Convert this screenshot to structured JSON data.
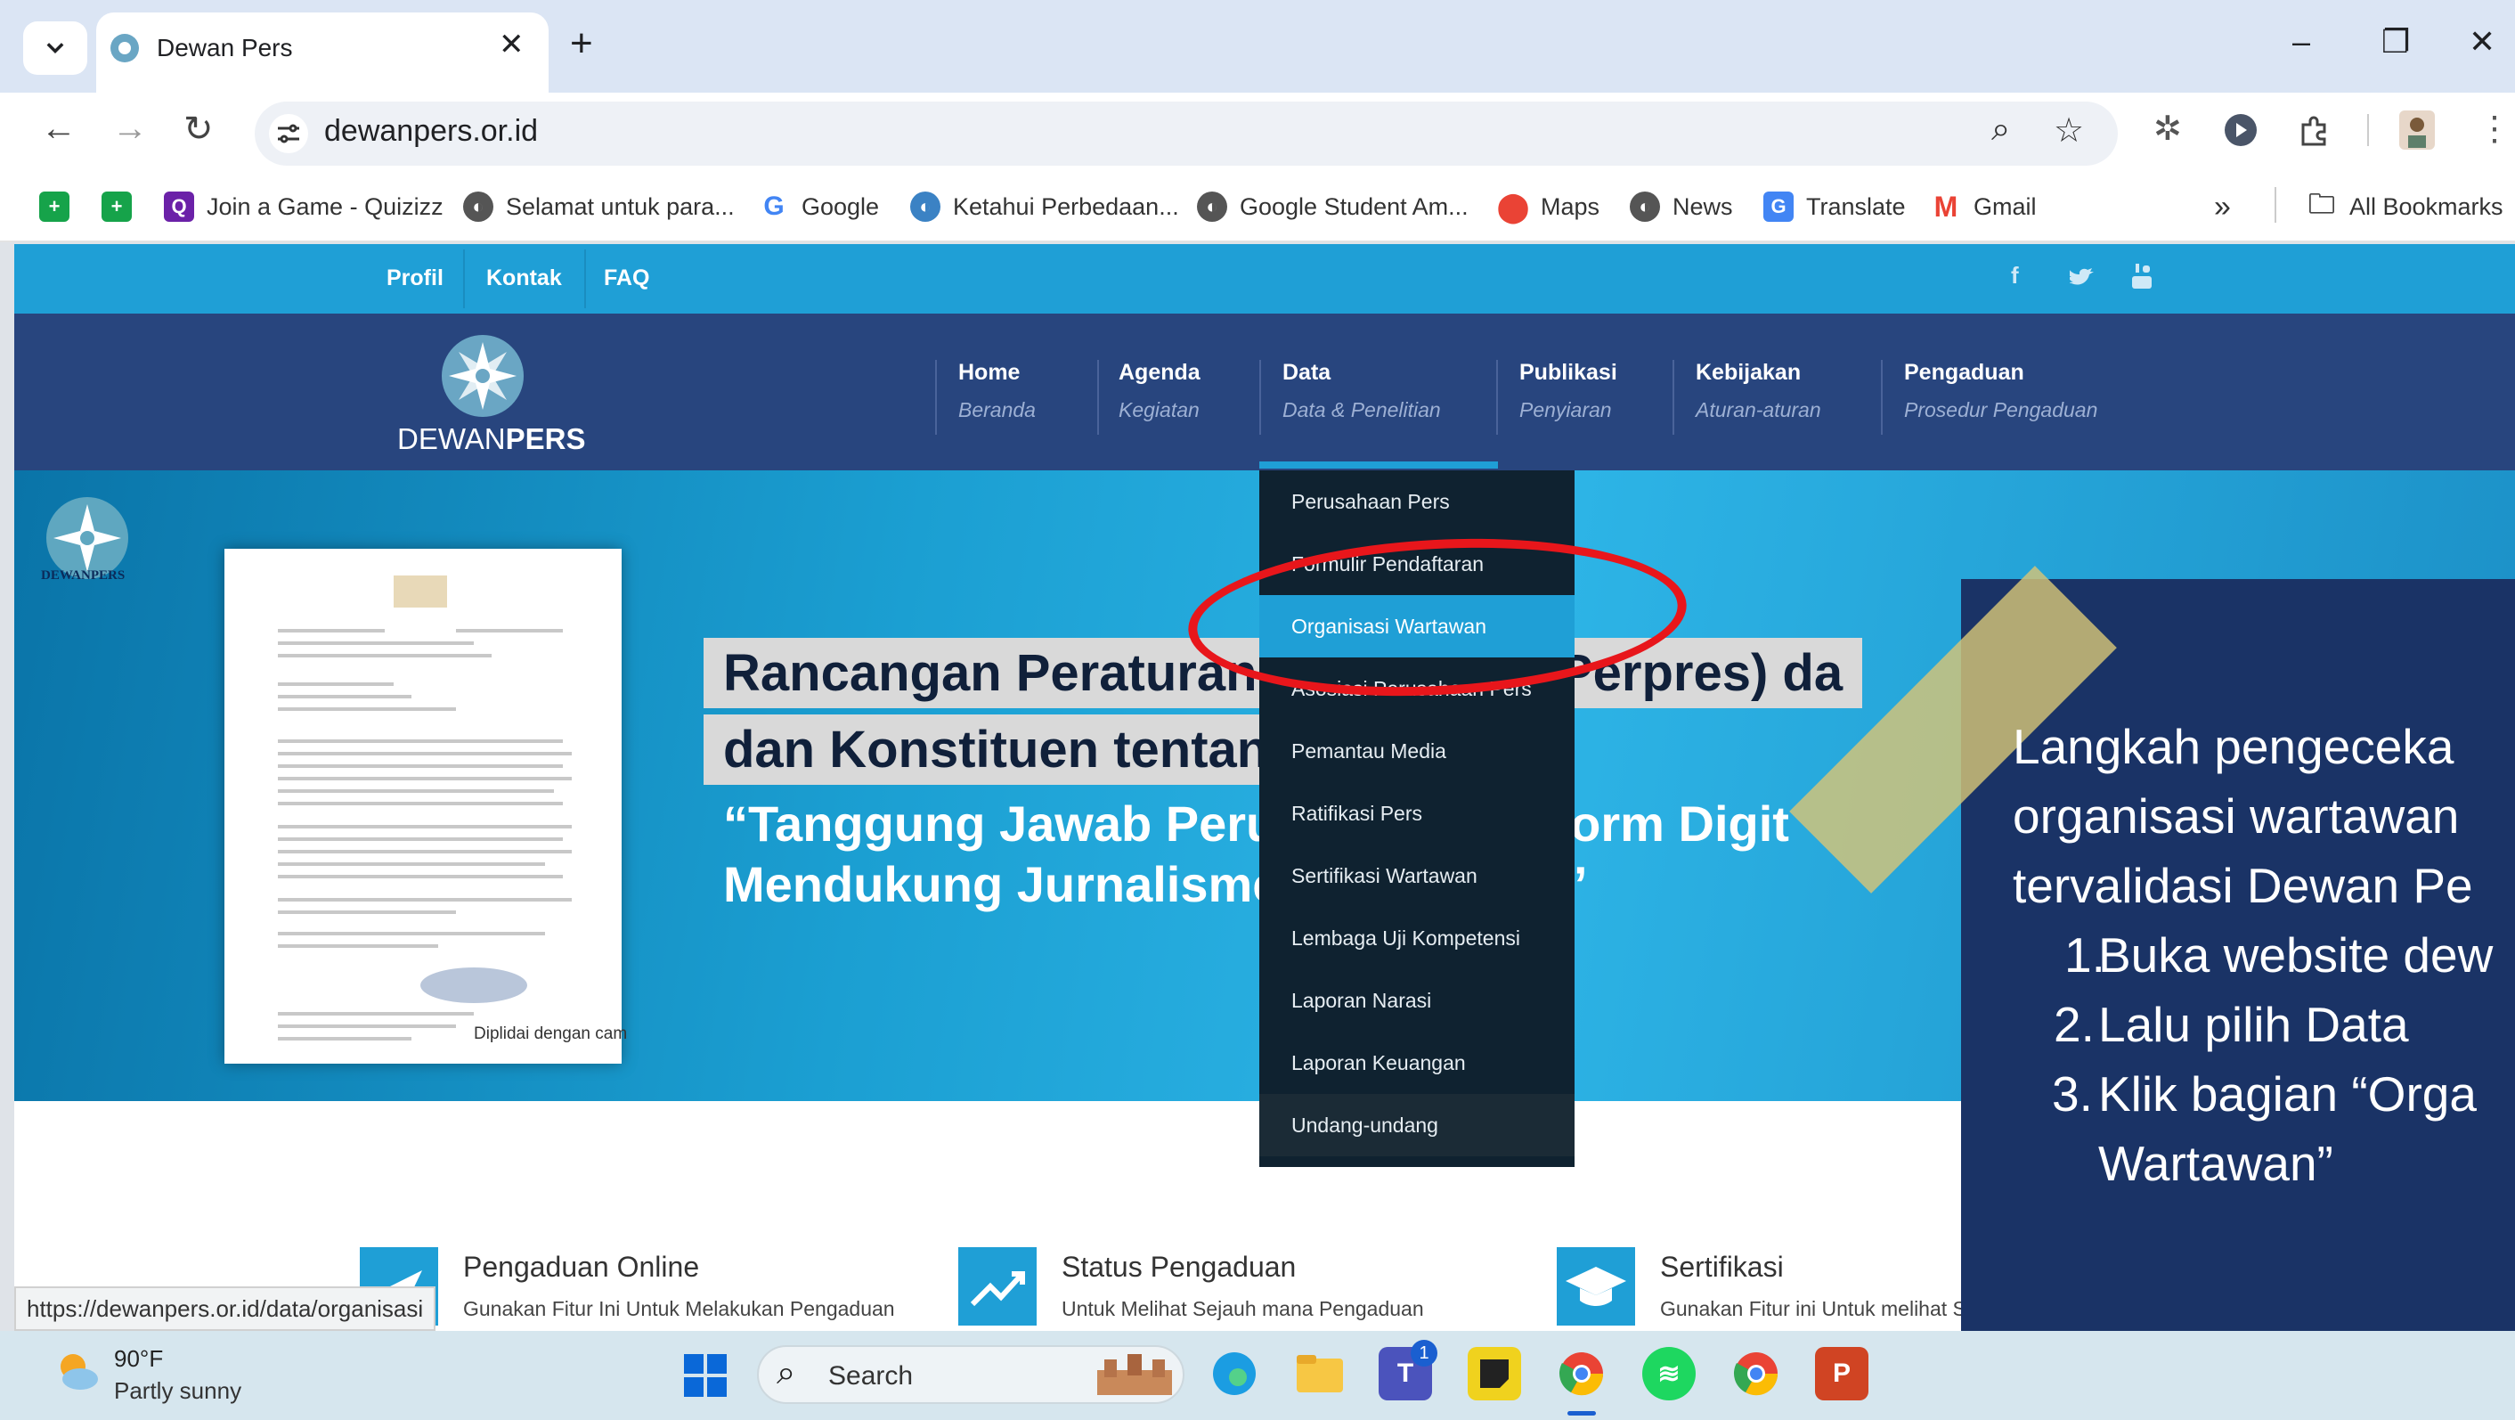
{
  "browser": {
    "tab_title": "Dewan Pers",
    "url": "dewanpers.or.id",
    "bookmarks": [
      {
        "label": "",
        "icon": "green-plus-icon"
      },
      {
        "label": "",
        "icon": "green-plus-icon"
      },
      {
        "label": "Join a Game - Quizizz",
        "icon": "quizizz-icon"
      },
      {
        "label": "Selamat untuk para...",
        "icon": "globe-icon"
      },
      {
        "label": "Google",
        "icon": "google-icon"
      },
      {
        "label": "Ketahui Perbedaan...",
        "icon": "globe-icon"
      },
      {
        "label": "Google Student Am...",
        "icon": "globe-icon"
      },
      {
        "label": "Maps",
        "icon": "maps-icon"
      },
      {
        "label": "News",
        "icon": "globe-icon"
      },
      {
        "label": "Translate",
        "icon": "translate-icon"
      },
      {
        "label": "Gmail",
        "icon": "gmail-icon"
      }
    ],
    "more_bookmarks": "»",
    "all_bookmarks": "All Bookmarks",
    "status_url": "https://dewanpers.or.id/data/organisasi"
  },
  "site": {
    "top_links": [
      "Profil",
      "Kontak",
      "FAQ"
    ],
    "social": [
      "f",
      "t",
      "yt"
    ],
    "logo_text_light": "DEWAN",
    "logo_text_bold": "PERS",
    "nav": [
      {
        "title": "Home",
        "sub": "Beranda"
      },
      {
        "title": "Agenda",
        "sub": "Kegiatan"
      },
      {
        "title": "Data",
        "sub": "Data & Penelitian"
      },
      {
        "title": "Publikasi",
        "sub": "Penyiaran"
      },
      {
        "title": "Kebijakan",
        "sub": "Aturan-aturan"
      },
      {
        "title": "Pengaduan",
        "sub": "Prosedur Pengaduan"
      }
    ],
    "banner": {
      "logo_text": "DEWANPERS",
      "letter_tail": "Diplidai dengan cam",
      "headline1": "Rancangan Peraturan Presiden (RPerpres) da",
      "headline2": "dan Konstituen tentang:",
      "quote1": "“Tanggung Jawab Perusahaan Platform Digit",
      "quote2": "Mendukung Jurnalisme Berkualitas”"
    },
    "data_menu": [
      "Perusahaan Pers",
      "Formulir Pendaftaran",
      "Organisasi Wartawan",
      "Asosiasi Perusahaan Pers",
      "Pemantau Media",
      "Ratifikasi Pers",
      "Sertifikasi Wartawan",
      "Lembaga Uji Kompetensi",
      "Laporan Narasi",
      "Laporan Keuangan",
      "Undang-undang"
    ],
    "data_menu_active": "Organisasi Wartawan",
    "features": [
      {
        "title": "Pengaduan Online",
        "desc": "Gunakan Fitur Ini Untuk Melakukan Pengaduan",
        "icon": "send-icon"
      },
      {
        "title": "Status Pengaduan",
        "desc": "Untuk Melihat Sejauh mana Pengaduan",
        "icon": "chart-up-icon"
      },
      {
        "title": "Sertifikasi",
        "desc": "Gunakan Fitur ini Untuk melihat S",
        "icon": "graduation-cap-icon"
      }
    ]
  },
  "overlay": {
    "lines": [
      "Langkah pengeceka",
      "organisasi wartawan",
      "tervalidasi Dewan Pe"
    ],
    "steps": [
      {
        "num": "1.",
        "text": "Buka website dew"
      },
      {
        "num": "2.",
        "text": "Lalu pilih Data"
      },
      {
        "num": "3.",
        "text": "Klik bagian “Orga"
      }
    ],
    "step3_cont": "Wartawan”"
  },
  "taskbar": {
    "weather_temp": "90°F",
    "weather_desc": "Partly sunny",
    "search_label": "Search",
    "teams_badge": "1"
  },
  "colors": {
    "site_topbar": "#1f9fd6",
    "site_header": "#28457e",
    "dropdown_bg": "#0f2230",
    "highlight_red": "#e8161b",
    "panel_bg": "#1a3366"
  }
}
